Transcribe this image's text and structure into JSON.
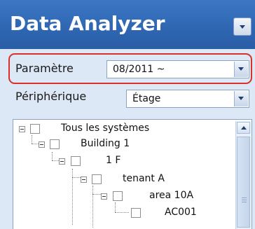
{
  "app": {
    "title": "Data Analyzer"
  },
  "filters": {
    "parameter": {
      "label": "Paramètre",
      "value": "08/2011 ~"
    },
    "device": {
      "label": "Périphérique",
      "value": "Étage"
    }
  },
  "tree": {
    "nodes": [
      {
        "label": "Tous les systèmes",
        "expanded": true,
        "checked": false
      },
      {
        "label": "Building 1",
        "expanded": true,
        "checked": false
      },
      {
        "label": "1 F",
        "expanded": true,
        "checked": false
      },
      {
        "label": "tenant A",
        "expanded": true,
        "checked": false
      },
      {
        "label": "area 10A",
        "expanded": true,
        "checked": false
      },
      {
        "label": "AC001",
        "expanded": false,
        "checked": false
      }
    ]
  },
  "colors": {
    "header": "#2f67b3",
    "highlight_border": "#d9302a",
    "panel": "#dce8f6"
  },
  "icons": {
    "collapse": "minus-box-icon",
    "dropdown": "chevron-down-icon",
    "scroll_up": "arrow-up-icon"
  }
}
